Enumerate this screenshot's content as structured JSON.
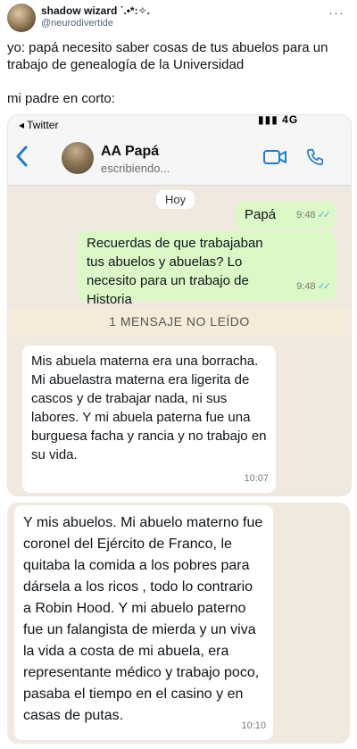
{
  "tweet": {
    "display_name": "shadow wizard ᐝ.•*:✧.",
    "handle": "@neurodivertide",
    "more": "···",
    "line1": "yo: papá necesito saber cosas de tus abuelos para un trabajo de genealogía de la Universidad",
    "line2": "mi padre en corto:"
  },
  "screenshot": {
    "back_label": "◂ Twitter",
    "signal_text": "▮▮▮ 4G",
    "chat": {
      "contact_name": "AA Papá",
      "contact_status": "escribiendo...",
      "day_label": "Hoy",
      "unread_label": "1 MENSAJE NO LEÍDO",
      "messages": [
        {
          "text": "Papá",
          "time": "9:48",
          "ticks": "✓✓"
        },
        {
          "text": "Recuerdas de que trabajaban tus abuelos y abuelas? Lo necesito para un trabajo de Historia",
          "time": "9:48",
          "ticks": "✓✓"
        },
        {
          "text": "Mis abuela materna era una borracha. Mi abuelastra materna era ligerita de cascos y de trabajar nada, ni sus labores. Y mi abuela paterna fue una burguesa facha y rancia y no trabajo en su vida.",
          "time": "10:07"
        },
        {
          "text": "Y mis abuelos. Mi abuelo materno fue coronel del Ejército de Franco, le quitaba la comida a los pobres para dársela a los ricos , todo lo contrario a Robin Hood. Y mi abuelo paterno fue un falangista de mierda y un viva la vida a costa de mi abuela, era representante médico y trabajo poco, pasaba el tiempo en el casino y en casas de putas.",
          "time": "10:10"
        }
      ]
    },
    "icons": {
      "back": "chevron-left-icon",
      "video": "video-camera-icon",
      "call": "phone-icon",
      "read": "double-check-icon"
    },
    "colors": {
      "accent": "#1a7dd6",
      "out_bubble": "#dcf8c6",
      "in_bubble": "#ffffff",
      "chat_bg": "#efe9e0",
      "read_ticks": "#4fb6ec"
    }
  }
}
